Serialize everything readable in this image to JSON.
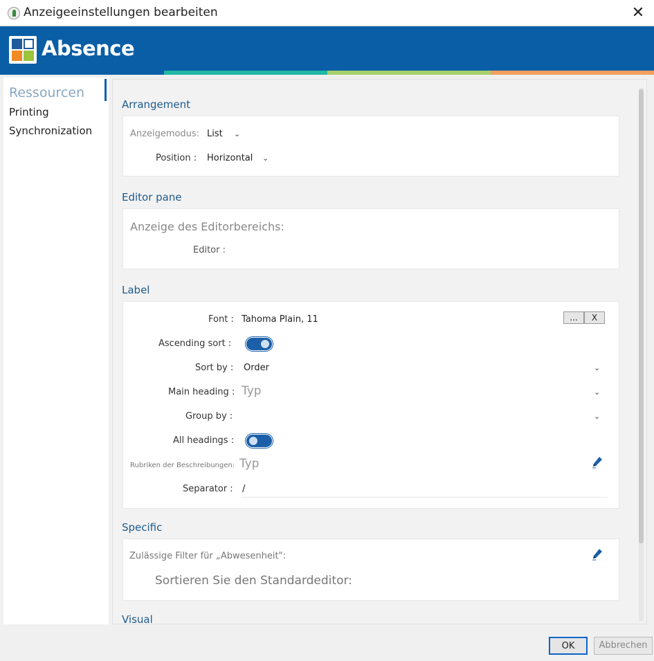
{
  "window": {
    "title": "Anzeigeeinstellungen bearbeiten",
    "close_glyph": "✕"
  },
  "banner": {
    "logo_text": "Absence",
    "colors": {
      "brand": "#0a5ea6",
      "stripe_teal": "#1fb6a5",
      "stripe_green": "#a5cf6a",
      "stripe_orange": "#f0a060"
    }
  },
  "sidebar": {
    "items": [
      {
        "label": "Ressourcen",
        "active": true
      },
      {
        "label": "Printing",
        "active": false
      },
      {
        "label": "Synchronization",
        "active": false
      }
    ]
  },
  "sections": {
    "arrangement": {
      "title": "Arrangement",
      "display_mode_label": "Anzeigemodus:",
      "display_mode_value": "List",
      "position_label": "Position :",
      "position_value": "Horizontal"
    },
    "editor_pane": {
      "title": "Editor pane",
      "heading": "Anzeige des Editorbereichs:",
      "editor_label": "Editor :"
    },
    "label": {
      "title": "Label",
      "font_label": "Font :",
      "font_value": "Tahoma Plain, 11",
      "font_btn_browse": "...",
      "font_btn_clear": "X",
      "ascending_label": "Ascending sort :",
      "ascending_on": true,
      "sort_by_label": "Sort by :",
      "sort_by_value": "Order",
      "main_heading_label": "Main heading :",
      "main_heading_placeholder": "Typ",
      "group_by_label": "Group by :",
      "all_headings_label": "All headings :",
      "all_headings_on": false,
      "desc_headings_label": "Rubriken der Beschreibungen:",
      "desc_headings_placeholder": "Typ",
      "separator_label": "Separator :",
      "separator_value": "/"
    },
    "specific": {
      "title": "Specific",
      "filters_label": "Zulässige Filter für „Abwesenheit\":",
      "default_editor_label": "Sortieren Sie den Standardeditor:"
    },
    "visual": {
      "title": "Visual"
    }
  },
  "footer": {
    "ok_label": "OK",
    "cancel_label": "Abbrechen"
  }
}
